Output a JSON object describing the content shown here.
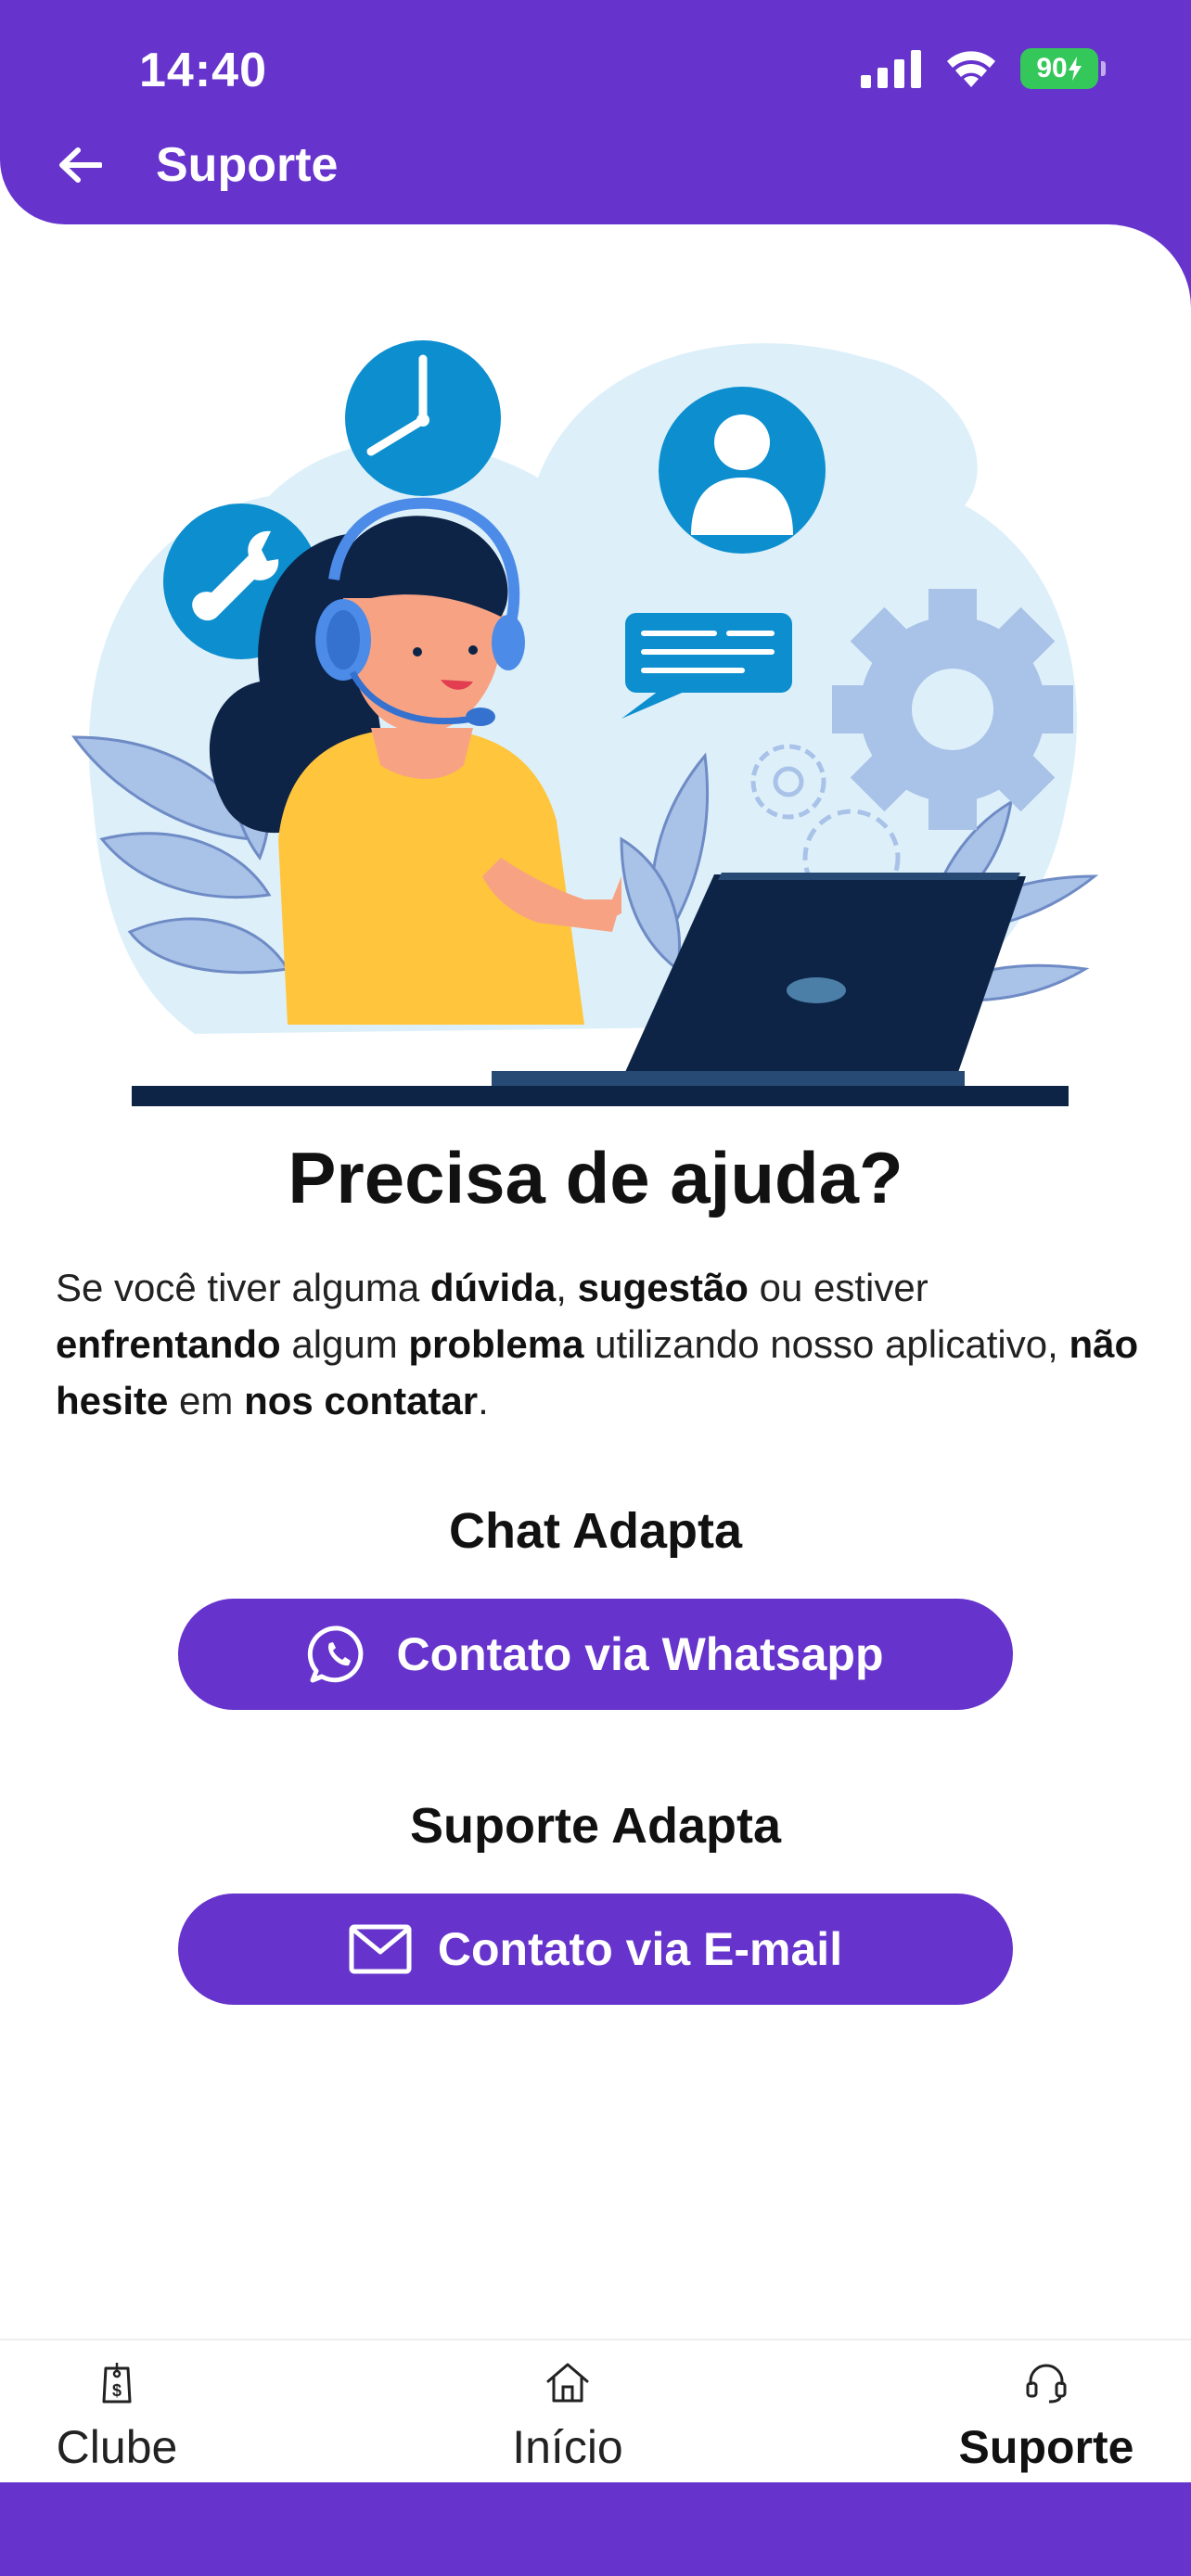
{
  "status_bar": {
    "time": "14:40",
    "battery": "90"
  },
  "header": {
    "title": "Suporte"
  },
  "main": {
    "heading": "Precisa de ajuda?",
    "paragraph": [
      {
        "t": "Se você tiver alguma ",
        "b": false
      },
      {
        "t": "dúvida",
        "b": true
      },
      {
        "t": ", ",
        "b": false
      },
      {
        "t": "sugestão",
        "b": true
      },
      {
        "t": " ou estiver ",
        "b": false
      },
      {
        "t": "enfrentando",
        "b": true
      },
      {
        "t": " algum ",
        "b": false
      },
      {
        "t": "problema",
        "b": true
      },
      {
        "t": " utilizando nosso aplicativo, ",
        "b": false
      },
      {
        "t": "não hesite",
        "b": true
      },
      {
        "t": " em ",
        "b": false
      },
      {
        "t": "nos contatar",
        "b": true
      },
      {
        "t": ".",
        "b": false
      }
    ],
    "chat_section": {
      "title": "Chat Adapta",
      "button_label": "Contato via Whatsapp",
      "icon": "whatsapp-icon"
    },
    "email_section": {
      "title": "Suporte Adapta",
      "button_label": "Contato via E-mail",
      "icon": "mail-icon"
    }
  },
  "tabbar": {
    "items": [
      {
        "label": "Clube",
        "icon": "price-tag-icon",
        "active": false
      },
      {
        "label": "Início",
        "icon": "home-icon",
        "active": false
      },
      {
        "label": "Suporte",
        "icon": "headset-icon",
        "active": true
      }
    ]
  },
  "colors": {
    "primary": "#6633CC",
    "battery": "#34C759"
  }
}
